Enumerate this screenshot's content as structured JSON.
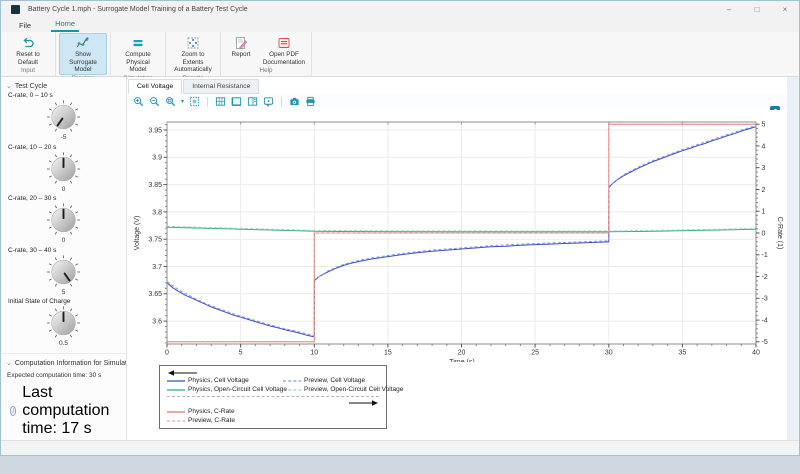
{
  "window": {
    "title": "Battery Cycle 1.mph - Surrogate Model Training of a Battery Test Cycle",
    "controls": {
      "minimize": "–",
      "maximize": "□",
      "close": "×"
    }
  },
  "menu": {
    "tabs": [
      {
        "label": "File"
      },
      {
        "label": "Home"
      }
    ]
  },
  "ribbon": {
    "accent_color": "#1895a5",
    "groups": [
      {
        "name": "Input",
        "buttons": [
          {
            "label": "Reset to Default",
            "icon": "reset"
          }
        ]
      },
      {
        "name": "Preview",
        "buttons": [
          {
            "label": "Show Surrogate Model",
            "icon": "surrogate",
            "active": true
          }
        ]
      },
      {
        "name": "Simulation",
        "buttons": [
          {
            "label": "Compute Physical Model",
            "icon": "compute"
          }
        ]
      },
      {
        "name": "Results",
        "buttons": [
          {
            "label": "Zoom to Extents Automatically",
            "icon": "zoom-extents"
          }
        ]
      },
      {
        "name": "Help",
        "buttons": [
          {
            "label": "Report",
            "icon": "report"
          },
          {
            "label": "Open PDF Documentation",
            "icon": "pdf"
          }
        ]
      }
    ]
  },
  "sidebar": {
    "test_cycle": {
      "title": "Test Cycle",
      "knobs": [
        {
          "label": "C-rate, 0 – 10 s",
          "value": "-5",
          "pointer_angle_deg": -145
        },
        {
          "label": "C-rate, 10 – 20 s",
          "value": "0",
          "pointer_angle_deg": 0
        },
        {
          "label": "C-rate, 20 – 30 s",
          "value": "0",
          "pointer_angle_deg": 0
        },
        {
          "label": "C-rate, 30 – 40 s",
          "value": "5",
          "pointer_angle_deg": 145
        },
        {
          "label": "Initial State of Charge",
          "value": "0.5",
          "pointer_angle_deg": 0
        }
      ]
    },
    "computation": {
      "title": "Computation Information for Simulation",
      "expected": "Expected computation time:  30 s",
      "last": "Last computation time: 17 s"
    }
  },
  "graphics": {
    "tabs": [
      {
        "label": "Cell Voltage",
        "active": true
      },
      {
        "label": "Internal Resistance",
        "active": false
      }
    ],
    "toolbar_icons": [
      "zoom-in",
      "zoom-out",
      "zoom-extents",
      "dropdown",
      "zoom-box",
      "sep",
      "grid",
      "axis",
      "legend-toggle",
      "tooltip",
      "sep",
      "camera",
      "print"
    ]
  },
  "chart_data": {
    "type": "line",
    "title": "",
    "xlabel": "Time (s)",
    "ylabel_left": "Voltage (V)",
    "ylabel_right": "C-Rate (1)",
    "xlim": [
      0,
      40
    ],
    "ylim_left": [
      3.558,
      3.9646
    ],
    "ylim_right": [
      -5.1,
      5.1
    ],
    "xticks": [
      0,
      5,
      10,
      15,
      20,
      25,
      30,
      35,
      40
    ],
    "yticks_left": [
      3.6,
      3.65,
      3.7,
      3.75,
      3.8,
      3.85,
      3.9,
      3.95
    ],
    "yticks_right": [
      -5,
      -4,
      -3,
      -2,
      -1,
      0,
      1,
      2,
      3,
      4,
      5
    ],
    "x_minor_step": 1,
    "y_left_minor_step": 0.01,
    "y_right_minor_step": 0.2,
    "grid": true,
    "legend_position": "below-left",
    "series": [
      {
        "id": "physics-cell-voltage",
        "name": "Physics, Cell Voltage",
        "axis": "left",
        "color": "#3a50c2",
        "dash": null,
        "points": [
          [
            0,
            3.67
          ],
          [
            0.4,
            3.661
          ],
          [
            0.8,
            3.654
          ],
          [
            1.2,
            3.648
          ],
          [
            1.6,
            3.643
          ],
          [
            2,
            3.638
          ],
          [
            2.5,
            3.632
          ],
          [
            3,
            3.626
          ],
          [
            3.5,
            3.621
          ],
          [
            4,
            3.616
          ],
          [
            4.5,
            3.611
          ],
          [
            5,
            3.607
          ],
          [
            5.5,
            3.603
          ],
          [
            6,
            3.599
          ],
          [
            6.5,
            3.595
          ],
          [
            7,
            3.591
          ],
          [
            7.5,
            3.588
          ],
          [
            8,
            3.584
          ],
          [
            8.5,
            3.581
          ],
          [
            9,
            3.578
          ],
          [
            9.5,
            3.574
          ],
          [
            10,
            3.571
          ],
          [
            10.01,
            3.674
          ],
          [
            10.3,
            3.681
          ],
          [
            10.7,
            3.687
          ],
          [
            11,
            3.691
          ],
          [
            11.5,
            3.697
          ],
          [
            12,
            3.702
          ],
          [
            12.5,
            3.706
          ],
          [
            13,
            3.709
          ],
          [
            14,
            3.714
          ],
          [
            15,
            3.718
          ],
          [
            16,
            3.722
          ],
          [
            17,
            3.725
          ],
          [
            18,
            3.728
          ],
          [
            19,
            3.73
          ],
          [
            20,
            3.732
          ],
          [
            21,
            3.734
          ],
          [
            22,
            3.736
          ],
          [
            23,
            3.737
          ],
          [
            24,
            3.739
          ],
          [
            25,
            3.74
          ],
          [
            26,
            3.741
          ],
          [
            27,
            3.742
          ],
          [
            28,
            3.743
          ],
          [
            29,
            3.744
          ],
          [
            30,
            3.745
          ],
          [
            30.01,
            3.845
          ],
          [
            30.3,
            3.853
          ],
          [
            30.7,
            3.861
          ],
          [
            31,
            3.866
          ],
          [
            31.5,
            3.873
          ],
          [
            32,
            3.88
          ],
          [
            32.5,
            3.886
          ],
          [
            33,
            3.892
          ],
          [
            33.5,
            3.897
          ],
          [
            34,
            3.902
          ],
          [
            34.5,
            3.907
          ],
          [
            35,
            3.912
          ],
          [
            35.5,
            3.916
          ],
          [
            36,
            3.921
          ],
          [
            36.5,
            3.925
          ],
          [
            37,
            3.93
          ],
          [
            37.5,
            3.934
          ],
          [
            38,
            3.939
          ],
          [
            38.5,
            3.943
          ],
          [
            39,
            3.948
          ],
          [
            39.5,
            3.952
          ],
          [
            40,
            3.956
          ]
        ]
      },
      {
        "id": "preview-cell-voltage",
        "name": "Preview, Cell Voltage",
        "axis": "left",
        "color": "#8894e8",
        "dash": "3 2.2",
        "points": [
          [
            0,
            3.672
          ],
          [
            1,
            3.654
          ],
          [
            2,
            3.64
          ],
          [
            3,
            3.628
          ],
          [
            4,
            3.618
          ],
          [
            5,
            3.609
          ],
          [
            6,
            3.601
          ],
          [
            7,
            3.593
          ],
          [
            8,
            3.586
          ],
          [
            9,
            3.58
          ],
          [
            10,
            3.573
          ],
          [
            10.01,
            3.676
          ],
          [
            11,
            3.693
          ],
          [
            12,
            3.704
          ],
          [
            13,
            3.711
          ],
          [
            14,
            3.716
          ],
          [
            15,
            3.72
          ],
          [
            16,
            3.724
          ],
          [
            17,
            3.727
          ],
          [
            18,
            3.73
          ],
          [
            20,
            3.734
          ],
          [
            22,
            3.738
          ],
          [
            24,
            3.741
          ],
          [
            26,
            3.743
          ],
          [
            28,
            3.745
          ],
          [
            30,
            3.747
          ],
          [
            30.01,
            3.847
          ],
          [
            31,
            3.868
          ],
          [
            32,
            3.882
          ],
          [
            33,
            3.894
          ],
          [
            34,
            3.904
          ],
          [
            35,
            3.914
          ],
          [
            36,
            3.923
          ],
          [
            37,
            3.932
          ],
          [
            38,
            3.941
          ],
          [
            39,
            3.95
          ],
          [
            40,
            3.958
          ]
        ]
      },
      {
        "id": "physics-open-circuit-cell-voltage",
        "name": "Physics, Open-Circuit Cell Voltage",
        "axis": "left",
        "color": "#2fae87",
        "dash": null,
        "points": [
          [
            0,
            3.772
          ],
          [
            2,
            3.7705
          ],
          [
            4,
            3.769
          ],
          [
            6,
            3.7675
          ],
          [
            8,
            3.766
          ],
          [
            10,
            3.7645
          ],
          [
            12,
            3.764
          ],
          [
            15,
            3.7638
          ],
          [
            20,
            3.7636
          ],
          [
            25,
            3.7635
          ],
          [
            30,
            3.7635
          ],
          [
            32,
            3.764
          ],
          [
            34,
            3.765
          ],
          [
            36,
            3.766
          ],
          [
            38,
            3.767
          ],
          [
            40,
            3.768
          ]
        ]
      },
      {
        "id": "preview-open-circuit-cell-voltage",
        "name": "Preview, Open-Circuit Cell Voltage",
        "axis": "left",
        "color": "#8fd8be",
        "dash": "3 2.2",
        "points": [
          [
            0,
            3.7735
          ],
          [
            2,
            3.772
          ],
          [
            4,
            3.7705
          ],
          [
            6,
            3.769
          ],
          [
            8,
            3.7675
          ],
          [
            10,
            3.766
          ],
          [
            15,
            3.7653
          ],
          [
            20,
            3.7651
          ],
          [
            25,
            3.765
          ],
          [
            30,
            3.765
          ],
          [
            34,
            3.7665
          ],
          [
            38,
            3.7685
          ],
          [
            40,
            3.7695
          ]
        ]
      },
      {
        "id": "physics-c-rate",
        "name": "Physics, C-Rate",
        "axis": "right",
        "color": "#e2756b",
        "dash": null,
        "points": [
          [
            0,
            0
          ],
          [
            0,
            -5
          ],
          [
            10,
            -5
          ],
          [
            10,
            0
          ],
          [
            30,
            0
          ],
          [
            30,
            5
          ],
          [
            40,
            5
          ]
        ]
      },
      {
        "id": "preview-c-rate",
        "name": "Preview, C-Rate",
        "axis": "right",
        "color": "#eba49d",
        "dash": "3 2.2",
        "points": [
          [
            0,
            0
          ],
          [
            0,
            -5
          ],
          [
            10,
            -5
          ],
          [
            10,
            0
          ],
          [
            30,
            0
          ],
          [
            30,
            5
          ],
          [
            40,
            5
          ]
        ]
      }
    ]
  }
}
